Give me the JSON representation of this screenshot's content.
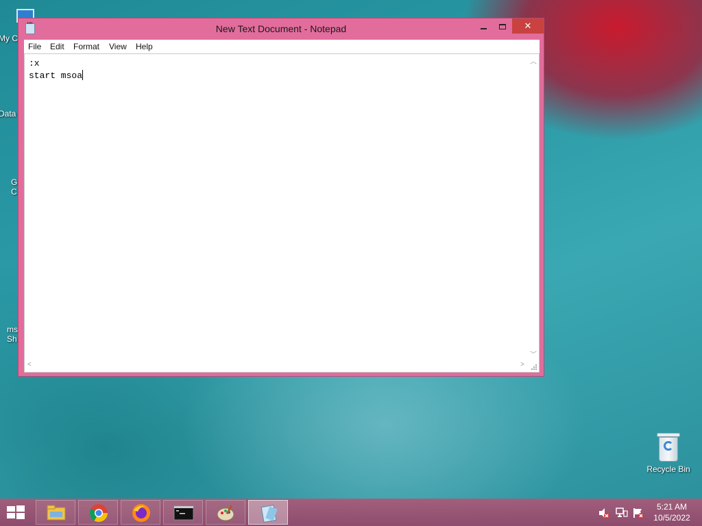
{
  "desktop": {
    "icons": [
      {
        "label": "My C"
      },
      {
        "label": "Data"
      },
      {
        "label": "G\nC"
      },
      {
        "label": "ms\nSh"
      }
    ],
    "recycle_bin": {
      "label": "Recycle Bin"
    }
  },
  "window": {
    "title": "New Text Document - Notepad",
    "menu": [
      "File",
      "Edit",
      "Format",
      "View",
      "Help"
    ],
    "lines": [
      ":x",
      "start msoa"
    ]
  },
  "taskbar": {
    "apps": [
      {
        "name": "file-explorer"
      },
      {
        "name": "chrome"
      },
      {
        "name": "firefox"
      },
      {
        "name": "command-prompt"
      },
      {
        "name": "paint"
      },
      {
        "name": "notepad",
        "active": true
      }
    ],
    "clock": {
      "time": "5:21 AM",
      "date": "10/5/2022"
    }
  },
  "colors": {
    "window_frame": "#e26d9c",
    "taskbar": "#a05a78",
    "close_button": "#c9423f"
  }
}
